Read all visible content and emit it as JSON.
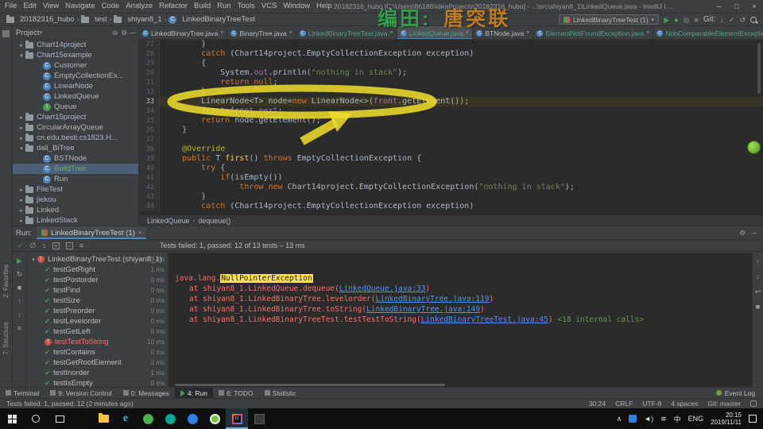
{
  "window": {
    "title": "20182316_hubo [C:\\Users\\86186\\IdeaProjects\\20182316_hubo] - ...\\src\\shiyan8_1\\LinkedQueue.java - IntelliJ IDEA",
    "menus": [
      "File",
      "Edit",
      "View",
      "Navigate",
      "Code",
      "Analyze",
      "Refactor",
      "Build",
      "Run",
      "Tools",
      "VCS",
      "Window",
      "Help"
    ],
    "controls": {
      "minimize": "─",
      "maximize": "□",
      "close": "×"
    }
  },
  "watermark": {
    "part1": "编田:",
    "part2": "唐突联"
  },
  "toolbar": {
    "breadcrumbs": [
      {
        "label": "20182316_hubo",
        "icon": "folder-icon"
      },
      {
        "label": "test",
        "icon": "folder-icon"
      },
      {
        "label": "shiyan8_1",
        "icon": "package-icon"
      },
      {
        "label": "LinkedBinaryTreeTest",
        "icon": "class-icon"
      }
    ],
    "run_config": "LinkedBinaryTreeTest (1)",
    "git_label": "Git:"
  },
  "left_stripe": {
    "favorites": "2: Favorites",
    "structure": "7: Structure"
  },
  "project_panel": {
    "title": "Project",
    "items": [
      {
        "label": "Chart14project",
        "kind": "folder",
        "indent": 1,
        "arrow": "collapsed"
      },
      {
        "label": "Chart15example",
        "kind": "folder",
        "indent": 1,
        "arrow": "expanded"
      },
      {
        "label": "Customer",
        "kind": "class",
        "indent": 2
      },
      {
        "label": "EmptyCollectionEx...",
        "kind": "class",
        "indent": 2
      },
      {
        "label": "LinearNode",
        "kind": "class",
        "indent": 2
      },
      {
        "label": "LinkedQueue",
        "kind": "class",
        "indent": 2
      },
      {
        "label": "Queue",
        "kind": "interface",
        "indent": 2
      },
      {
        "label": "Chart15project",
        "kind": "folder",
        "indent": 1,
        "arrow": "collapsed"
      },
      {
        "label": "CircularArrayQueue",
        "kind": "folder",
        "indent": 1,
        "arrow": "collapsed"
      },
      {
        "label": "cn.edu.besti.cs1823.H...",
        "kind": "folder",
        "indent": 1,
        "arrow": "collapsed"
      },
      {
        "label": "dali_BiTree",
        "kind": "folder",
        "indent": 1,
        "arrow": "expanded"
      },
      {
        "label": "BSTNode",
        "kind": "class",
        "indent": 2
      },
      {
        "label": "BuildTree",
        "kind": "class",
        "indent": 2,
        "selected": true,
        "vcs": "added"
      },
      {
        "label": "Run",
        "kind": "class",
        "indent": 2
      },
      {
        "label": "FileTest",
        "kind": "folder",
        "indent": 1,
        "arrow": "collapsed"
      },
      {
        "label": "jiekou",
        "kind": "folder",
        "indent": 1,
        "arrow": "collapsed"
      },
      {
        "label": "Linked",
        "kind": "folder",
        "indent": 1,
        "arrow": "collapsed"
      },
      {
        "label": "LinkedStack",
        "kind": "folder",
        "indent": 1,
        "arrow": "collapsed"
      }
    ]
  },
  "editor": {
    "tabs": [
      {
        "label": "LinkedBinaryTree.java"
      },
      {
        "label": "BinaryTree.java"
      },
      {
        "label": "LinkedBinaryTreeTest.java",
        "vcs": "added"
      },
      {
        "label": "LinkedQueue.java",
        "vcs": "added",
        "active": true
      },
      {
        "label": "BTNode.java"
      },
      {
        "label": "ElementNotFoundException.java",
        "vcs": "added"
      },
      {
        "label": "NonComparableElementException.java",
        "vcs": "added"
      }
    ],
    "breadcrumbs": [
      "LinkedQueue",
      "dequeue()"
    ],
    "lines": [
      {
        "num": 27,
        "segs": [
          {
            "t": "        }"
          }
        ]
      },
      {
        "num": 28,
        "segs": [
          {
            "t": "        "
          },
          {
            "t": "catch",
            "c": "kw"
          },
          {
            "t": " (Chart14project.EmptyCollectionException exception)"
          }
        ]
      },
      {
        "num": 29,
        "segs": [
          {
            "t": "        {"
          }
        ]
      },
      {
        "num": 30,
        "segs": [
          {
            "t": "            System."
          },
          {
            "t": "out",
            "c": "field"
          },
          {
            "t": ".println("
          },
          {
            "t": "\"nothing in stack\"",
            "c": "str"
          },
          {
            "t": ");"
          }
        ]
      },
      {
        "num": 31,
        "segs": [
          {
            "t": "            "
          },
          {
            "t": "return ",
            "c": "kw"
          },
          {
            "t": "null",
            "c": "kw"
          },
          {
            "t": ";"
          }
        ]
      },
      {
        "num": 32,
        "segs": [
          {
            "t": "        }"
          }
        ]
      },
      {
        "num": 33,
        "caret": true,
        "segs": [
          {
            "t": "        LinearNode<T> node="
          },
          {
            "t": "new",
            "c": "kw"
          },
          {
            "t": " LinearNode<>("
          },
          {
            "t": "front",
            "c": "field"
          },
          {
            "t": ".getElement());"
          }
        ]
      },
      {
        "num": 34,
        "segs": [
          {
            "t": "        "
          },
          {
            "t": "front",
            "c": "field"
          },
          {
            "t": "="
          },
          {
            "t": "front",
            "c": "field"
          },
          {
            "t": "."
          },
          {
            "t": "next",
            "c": "field"
          },
          {
            "t": ";"
          }
        ]
      },
      {
        "num": 35,
        "segs": [
          {
            "t": "        "
          },
          {
            "t": "return",
            "c": "kw"
          },
          {
            "t": " node.getElement();"
          }
        ]
      },
      {
        "num": 36,
        "segs": [
          {
            "t": "    }"
          }
        ]
      },
      {
        "num": 37,
        "segs": []
      },
      {
        "num": 38,
        "segs": [
          {
            "t": "    "
          },
          {
            "t": "@Override",
            "c": "ann"
          }
        ]
      },
      {
        "num": 39,
        "segs": [
          {
            "t": "    "
          },
          {
            "t": "public",
            "c": "kw"
          },
          {
            "t": " T "
          },
          {
            "t": "first",
            "c": "method"
          },
          {
            "t": "() "
          },
          {
            "t": "throws",
            "c": "kw"
          },
          {
            "t": " EmptyCollectionException {"
          }
        ]
      },
      {
        "num": 40,
        "segs": [
          {
            "t": "        "
          },
          {
            "t": "try",
            "c": "kw"
          },
          {
            "t": " {"
          }
        ]
      },
      {
        "num": 41,
        "segs": [
          {
            "t": "            "
          },
          {
            "t": "if",
            "c": "kw"
          },
          {
            "t": "(isEmpty())"
          }
        ]
      },
      {
        "num": 42,
        "segs": [
          {
            "t": "                "
          },
          {
            "t": "throw new",
            "c": "kw"
          },
          {
            "t": " Chart14project.EmptyCollectionException("
          },
          {
            "t": "\"nothing in stack\"",
            "c": "str"
          },
          {
            "t": ");"
          }
        ]
      },
      {
        "num": 43,
        "segs": [
          {
            "t": "        }"
          }
        ]
      },
      {
        "num": 44,
        "segs": [
          {
            "t": "        "
          },
          {
            "t": "catch",
            "c": "kw"
          },
          {
            "t": " (Chart14project.EmptyCollectionException exception)"
          }
        ]
      }
    ]
  },
  "run_panel": {
    "run_label": "Run:",
    "tab_label": "LinkedBinaryTreeTest (1)",
    "status": "Tests failed: 1, passed: 12 of 13 tests – 13 ms",
    "root_test": {
      "label": "LinkedBinaryTreeTest (shiyan8_1)",
      "time": "13 ms",
      "status": "failed"
    },
    "tests": [
      {
        "label": "testGetRight",
        "time": "1 ms",
        "status": "passed"
      },
      {
        "label": "testPostorder",
        "time": "0 ms",
        "status": "passed"
      },
      {
        "label": "testFind",
        "time": "0 ms",
        "status": "passed"
      },
      {
        "label": "testSize",
        "time": "0 ms",
        "status": "passed"
      },
      {
        "label": "testPreorder",
        "time": "0 ms",
        "status": "passed"
      },
      {
        "label": "testLevelorder",
        "time": "0 ms",
        "status": "passed"
      },
      {
        "label": "testGetLeft",
        "time": "0 ms",
        "status": "passed"
      },
      {
        "label": "testTestToString",
        "time": "10 ms",
        "status": "failed"
      },
      {
        "label": "testContains",
        "time": "0 ms",
        "status": "passed"
      },
      {
        "label": "testGetRootElement",
        "time": "0 ms",
        "status": "passed"
      },
      {
        "label": "testInorder",
        "time": "1 ms",
        "status": "passed"
      },
      {
        "label": "testIsEmpty",
        "time": "0 ms",
        "status": "passed"
      }
    ],
    "console": {
      "exception_prefix": "java.lang.",
      "exception_name": "NullPointerException",
      "frames": [
        {
          "prefix": "at shiyan8_1.LinkedQueue.dequeue(",
          "link": "LinkedQueue.java:33",
          "suffix": ")"
        },
        {
          "prefix": "at shiyan8_1.LinkedBinaryTree.levelorder(",
          "link": "LinkedBinaryTree.java:119",
          "suffix": ")"
        },
        {
          "prefix": "at shiyan8_1.LinkedBinaryTree.toString(",
          "link": "LinkedBinaryTree.java:149",
          "suffix": ")"
        },
        {
          "prefix": "at shiyan8_1.LinkedBinaryTreeTest.testTestToString(",
          "link": "LinkedBinaryTreeTest.java:45",
          "suffix": ") ",
          "note": "<18 internal calls>"
        }
      ]
    }
  },
  "tool_window_bar": {
    "buttons": [
      {
        "label": "Terminal"
      },
      {
        "label": "9: Version Control"
      },
      {
        "label": "0: Messages"
      },
      {
        "label": "4: Run",
        "active": true
      },
      {
        "label": "6: TODO"
      },
      {
        "label": "Statistic"
      }
    ],
    "event_log": "Event Log"
  },
  "status_bar": {
    "message": "Tests failed: 1, passed: 12 (2 minutes ago)",
    "caret_position": "30:24",
    "line_separator": "CRLF",
    "encoding": "UTF-8",
    "indent": "4 spaces",
    "git_branch": "Git: master"
  },
  "taskbar": {
    "ime": "中",
    "lang": "ENG",
    "time": "20:15",
    "date": "2019/11/11"
  }
}
